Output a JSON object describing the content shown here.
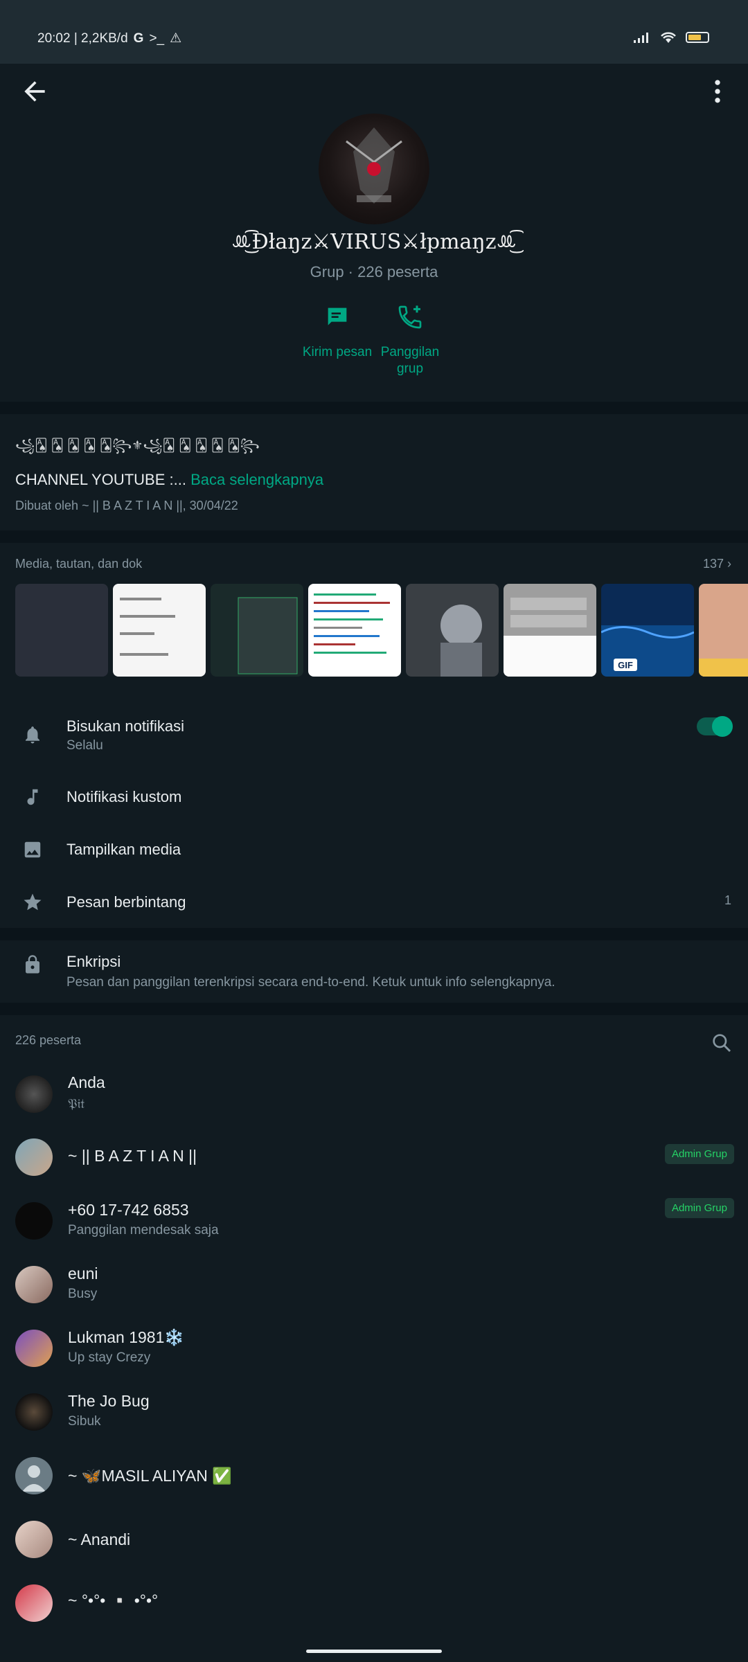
{
  "status_bar": {
    "time_speed": "20:02 | 2,2KB/d",
    "icons": [
      "google-g-icon",
      "terminal-icon",
      "warning-icon"
    ],
    "battery_icon": "battery-icon"
  },
  "header": {
    "group_name": "ꔛ͜͡Ɖłaŋz⚔VIRUS⚔łpmaŋzꔛ͜͡",
    "subtitle": "Grup · 226 peserta",
    "actions": [
      {
        "label": "Kirim pesan",
        "icon": "message-icon"
      },
      {
        "label": "Panggilan grup",
        "icon": "add-call-icon"
      }
    ]
  },
  "description": {
    "fancy_line": "꧁🂡 🂡 🂡 🂡 🂡꧂⚜꧁🂡 🂡 🂡 🂡 🂡꧂",
    "text": "CHANNEL YOUTUBE :... ",
    "read_more": "Baca selengkapnya",
    "created": "Dibuat oleh ~ || B A Z T I A N ||, 30/04/22"
  },
  "media": {
    "label": "Media, tautan, dan dok",
    "count": "137",
    "gif_label": "GIF"
  },
  "settings": [
    {
      "title": "Bisukan notifikasi",
      "subtitle": "Selalu",
      "icon": "bell-icon",
      "toggle_on": true
    },
    {
      "title": "Notifikasi kustom",
      "icon": "music-note-icon"
    },
    {
      "title": "Tampilkan media",
      "icon": "image-icon"
    },
    {
      "title": "Pesan berbintang",
      "icon": "star-icon",
      "count": "1"
    }
  ],
  "encryption": {
    "title": "Enkripsi",
    "subtitle": "Pesan dan panggilan terenkripsi secara end-to-end. Ketuk untuk info selengkapnya."
  },
  "members": {
    "label": "226 peserta",
    "admin_label": "Admin Grup",
    "list": [
      {
        "name": "Anda",
        "status": "𝔓𝔦𝔱",
        "admin": false
      },
      {
        "name": "~ || B A Z T I A N ||",
        "status": "",
        "admin": true
      },
      {
        "name": "+60 17-742 6853",
        "status": "Panggilan mendesak saja",
        "admin": true
      },
      {
        "name": "euni",
        "status": "Busy",
        "admin": false
      },
      {
        "name": "Lukman 1981❄️",
        "status": "Up stay Crezy",
        "admin": false
      },
      {
        "name": "The Jo Bug",
        "status": "Sibuk",
        "admin": false
      },
      {
        "name": "~ 🦋MASIL ALIYAN ✅",
        "status": "",
        "admin": false
      },
      {
        "name": "~ Anandi",
        "status": "",
        "admin": false
      },
      {
        "name": "~ °•°• ▫️ •°•°",
        "status": "",
        "admin": false
      }
    ]
  },
  "colors": {
    "accent": "#00a884",
    "background": "#0b141a",
    "panel": "#111b21",
    "secondary_text": "#8696a0"
  }
}
